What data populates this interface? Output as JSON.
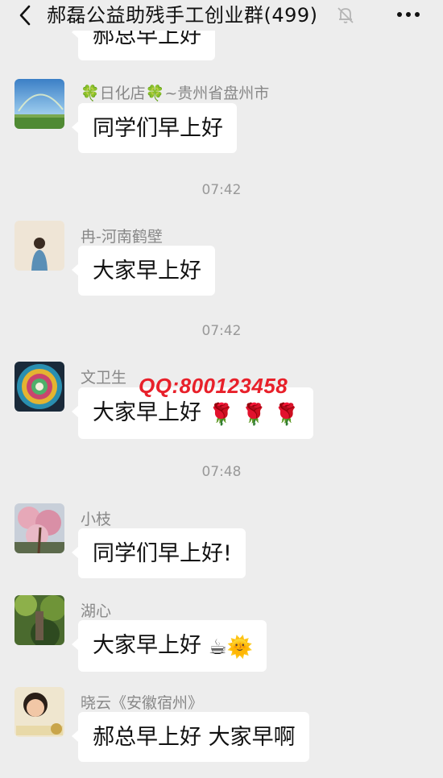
{
  "header": {
    "title": "郝磊公益助残手工创业群(499)"
  },
  "watermark": "QQ:800123458",
  "messages": [
    {
      "text": "郝总早上好"
    },
    {
      "name": "🍀日化店🍀~贵州省盘州市",
      "text": "同学们早上好"
    },
    {
      "time": "07:42"
    },
    {
      "name": "冉-河南鹤壁",
      "text": "大家早上好"
    },
    {
      "time": "07:42"
    },
    {
      "name": "文卫生",
      "text": "大家早上好",
      "emojis": "🌹 🌹 🌹"
    },
    {
      "time": "07:48"
    },
    {
      "name": "小枝",
      "text": "同学们早上好!"
    },
    {
      "name": "湖心",
      "text": "大家早上好",
      "emojis": "☕🌞"
    },
    {
      "name": "晓云《安徽宿州》",
      "text": "郝总早上好  大家早啊"
    }
  ]
}
